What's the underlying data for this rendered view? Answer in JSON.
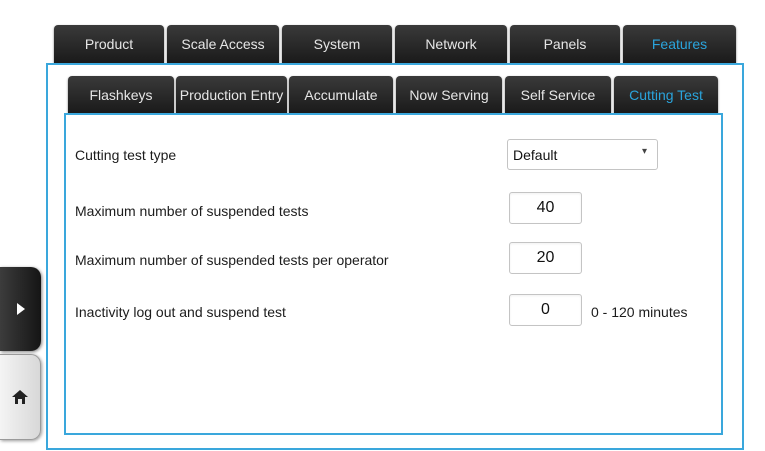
{
  "top_tabs": [
    {
      "label": "Product"
    },
    {
      "label": "Scale Access"
    },
    {
      "label": "System"
    },
    {
      "label": "Network"
    },
    {
      "label": "Panels"
    },
    {
      "label": "Features",
      "active": true
    }
  ],
  "sub_tabs": [
    {
      "label": "Flashkeys"
    },
    {
      "label": "Production Entry"
    },
    {
      "label": "Accumulate"
    },
    {
      "label": "Now Serving"
    },
    {
      "label": "Self Service"
    },
    {
      "label": "Cutting Test",
      "active": true
    }
  ],
  "settings": {
    "cutting_test_type": {
      "label": "Cutting test type",
      "value": "Default"
    },
    "max_suspended": {
      "label": "Maximum number of suspended tests",
      "value": "40"
    },
    "max_suspended_per_operator": {
      "label": "Maximum number of suspended tests per operator",
      "value": "20"
    },
    "inactivity": {
      "label": "Inactivity log out and suspend test",
      "value": "0",
      "range": "0 - 120 minutes"
    }
  },
  "side_buttons": {
    "expand_icon": "play-arrow-icon",
    "home_icon": "home-icon"
  },
  "colors": {
    "accent": "#3aa7dc",
    "tab_bg": "#2a2a2a",
    "active_tab_text": "#2aa4dc"
  }
}
